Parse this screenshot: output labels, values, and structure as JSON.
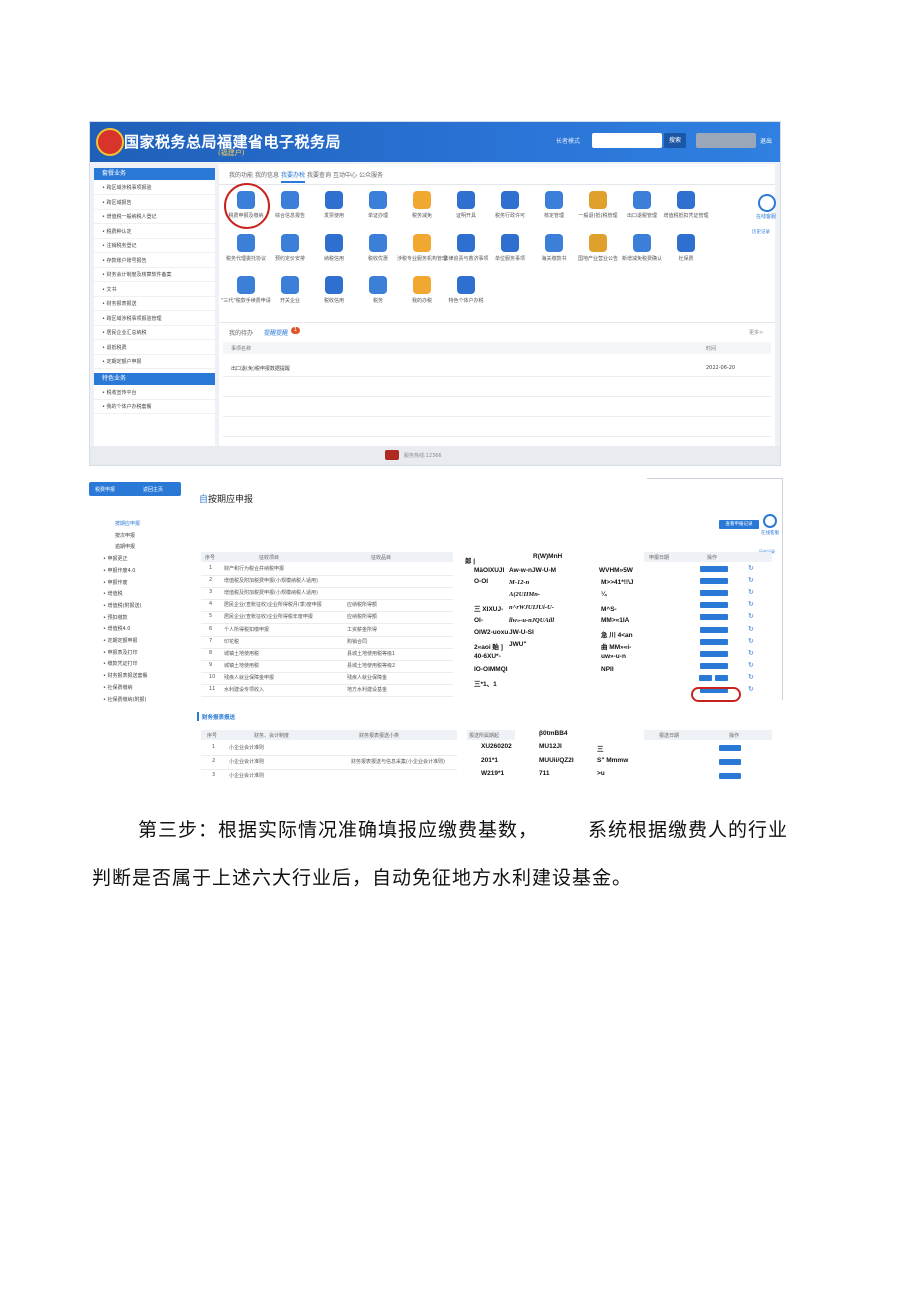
{
  "screenshot1": {
    "title": "国家税务总局福建省电子税务局",
    "subtitle": "(福建户)",
    "mode_label": "长者模式",
    "search_button": "搜索",
    "logout": "退出",
    "sidebar_head1": "套餐业务",
    "sidebar_items": [
      "跨区域涉税事项报验",
      "跨区域报告",
      "增值税一般纳税人登记",
      "税费种认定",
      "注销税务登记",
      "存款账户账号报告",
      "财务会计制度及核算软件备案",
      "文书",
      "财务报表报送",
      "跨区域涉税事项报验管理",
      "居民企业汇总纳税",
      "退抵税费",
      "定期定额户申报"
    ],
    "sidebar_head2": "特色业务",
    "sidebar_items2": [
      "税收宣传平台",
      "我的个体户办税套餐"
    ],
    "tabs": [
      "我的功能",
      "我的信息",
      "我要办税",
      "我要查询",
      "互动中心",
      "公众服务"
    ],
    "active_tab": "我要办税",
    "grid_row1": [
      "税费申报及缴纳",
      "综合信息报告",
      "发票使用",
      "单证办理",
      "税务减免",
      "证明开具",
      "税务行政许可",
      "核定管理",
      "一般退(抵)税管理",
      "出口退税管理",
      "增值税抵扣凭证管理"
    ],
    "grid_row2": [
      "税务代理委托协议",
      "预约定价安排",
      "纳税信用",
      "税收优惠",
      "涉税专业服务机构管理",
      "法律追责与救济事项",
      "单位服务事项",
      "海关缴款书",
      "国地产业营业公告",
      "新增减免税费确认",
      "社保费"
    ],
    "grid_row3": [
      "\"三代\"税款手续费申请",
      "开关企业",
      "税收信用",
      "税务",
      "我的办税",
      "特色个体户办税"
    ],
    "side_widget": "在线客服",
    "side_widget2": "历史记录",
    "notice_tabs": [
      "我的待办",
      "提醒提醒"
    ],
    "notice_badge": "1",
    "more_link": "更多>",
    "table_cols": [
      "事项名称",
      "时间"
    ],
    "table_row": {
      "name": "出口退(免)税申报数据提醒",
      "time": "2022-06-20"
    },
    "footer": "服务热线:12366"
  },
  "screenshot2": {
    "nav_left": "税费申报",
    "nav_right": "返回主页",
    "title_prefix": "自",
    "title": "按期应申报",
    "left_items": [
      "按期应申报",
      "按次申报",
      "逾期申报",
      "申报更正",
      "申报作废4.0",
      "申报作废",
      "增值税",
      "增值税(附报送)",
      "预扣缴款",
      "增值税4.0",
      "定期定额申报",
      "申报表及打印",
      "缴款凭证打印",
      "财务报表报送套餐",
      "社保费缴纳",
      "社保费缴纳(附报)"
    ],
    "right_button": "查看申报记录",
    "right_widget": "在线客服",
    "right_widget2": "历史记录",
    "table_cols": [
      "序号",
      "征收项目",
      "征收品目",
      "申报日期",
      "操作"
    ],
    "rows": [
      {
        "no": "1",
        "item": "财产和行为税合并纳税申报",
        "sub": ""
      },
      {
        "no": "2",
        "item": "增值税及附加税费申报(小规模纳税人适用)",
        "sub": ""
      },
      {
        "no": "3",
        "item": "增值税及附加税费申报(小规模纳税人适用)",
        "sub": ""
      },
      {
        "no": "4",
        "item": "居民企业(查账征收)企业所得税月(季)度申报",
        "sub": "应纳税所得额"
      },
      {
        "no": "5",
        "item": "居民企业(查账征收)企业所得税年度申报",
        "sub": "应纳税所得额"
      },
      {
        "no": "6",
        "item": "个人所得税扣缴申报",
        "sub": "工资薪金所得"
      },
      {
        "no": "7",
        "item": "印花税",
        "sub": "购销合同"
      },
      {
        "no": "8",
        "item": "城镇土地使用税",
        "sub": "县城土地使用税等级1"
      },
      {
        "no": "9",
        "item": "城镇土地使用税",
        "sub": "县城土地使用税等级2"
      },
      {
        "no": "10",
        "item": "残疾人就业保障金申报",
        "sub": "残疾人就业保障金"
      },
      {
        "no": "11",
        "item": "水利建设专项收入",
        "sub": "地方水利建设基金"
      }
    ],
    "ocr_mid_header": [
      "郎 |",
      "R(W)MnH",
      "WVHM»5W"
    ],
    "ocr_col1": [
      "MäOIXUJI",
      "O-OI",
      "",
      "三   XIXUJ-",
      "OI-",
      "OIW2-uoxu",
      "2«aoi 贻 ]",
      "40-6XU*-",
      "IO-OIMMQI",
      "三*1、1"
    ],
    "ocr_col2": [
      "Aw-w-nJW-U-M",
      "M-12-n",
      "A(2UIIMn-",
      "n^rWJUIJUi-U-",
      "llw»-u-nJQUAill",
      "JW-U-SI",
      "JWU\""
    ],
    "ocr_col3": [
      "M>>41*!!\\J",
      "¼",
      "M^S-",
      "MM>«1IA",
      "急 川  4<an",
      "曲  MM»«i-",
      "uw»-u-n",
      "NPII"
    ],
    "report_title": "财务报表报送",
    "report_cols": [
      "序号",
      "财务、会计制度",
      "财务报表报送小类",
      "报送所属期起",
      "报送日期",
      "操作"
    ],
    "report_rows": [
      {
        "no": "1",
        "std": "小企业会计准则",
        "sub": ""
      },
      {
        "no": "2",
        "std": "小企业会计准则",
        "sub": "财务报表报送与信息采集(小企业会计准则)"
      },
      {
        "no": "3",
        "std": "小企业会计准则",
        "sub": ""
      }
    ],
    "ocr_bot_col1": [
      "XU260202",
      "201*1",
      "W219*1"
    ],
    "ocr_bot_col2": [
      "β0tmBB4",
      "MU12JI",
      "MUUii/QZ2I",
      "711"
    ],
    "ocr_bot_col3": [
      "三",
      "S\" Mmmw",
      ">u"
    ]
  },
  "paragraph": {
    "line1a": "第三步：根据实际情况准确填报应缴费基数，",
    "line1b": "系统根据缴费人的行业",
    "line2": "判断是否属于上述六大行业后，自动免征地方水利建设基金。"
  }
}
